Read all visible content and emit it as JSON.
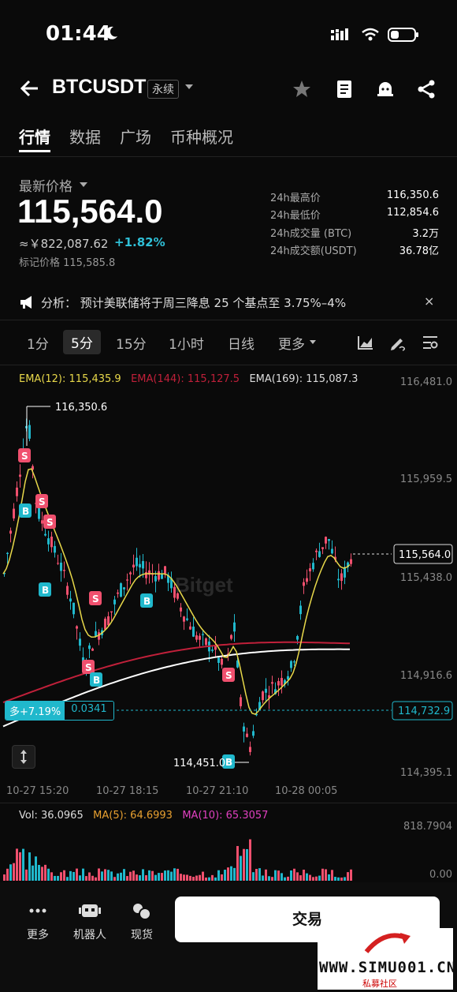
{
  "status": {
    "time": "01:44"
  },
  "header": {
    "symbol": "BTCUSDT",
    "badge": "永续"
  },
  "tabs": [
    "行情",
    "数据",
    "广场",
    "币种概况"
  ],
  "ticker": {
    "last_label": "最新价格",
    "price": "115,564.0",
    "cny": "≈￥822,087.62",
    "change": "+1.82%",
    "mark": "标记价格 115,585.8",
    "stats": [
      {
        "label": "24h最高价",
        "value": "116,350.6"
      },
      {
        "label": "24h最低价",
        "value": "112,854.6"
      },
      {
        "label": "24h成交量 (BTC)",
        "value": "3.2万"
      },
      {
        "label": "24h成交额(USDT)",
        "value": "36.78亿"
      }
    ]
  },
  "notice": {
    "text": "分析：  预计美联储将于周三降息 25 个基点至 3.75%–4%",
    "close": "×"
  },
  "intervals": [
    "1分",
    "5分",
    "15分",
    "1小时",
    "日线",
    "更多"
  ],
  "ema": {
    "ema12": "EMA(12): 115,435.9",
    "ema144": "EMA(144): 115,127.5",
    "ema169": "EMA(169): 115,087.3"
  },
  "chart_data": {
    "type": "candlestick",
    "y_axis_labels": [
      "116,481.0",
      "115,959.5",
      "115,438.0",
      "114,916.6",
      "114,395.1"
    ],
    "ylim": [
      114395.1,
      116481.0
    ],
    "x_axis_labels": [
      "10-27 15:20",
      "10-27 18:15",
      "10-27 21:10",
      "10-28 00:05"
    ],
    "high_label": "116,350.6",
    "low_label": "114,451.0",
    "current_price_label": "115,564.0",
    "position_line": {
      "label": "多+7.19%",
      "size": "0.0341",
      "price_label": "114,732.9"
    },
    "watermark": "Bitget",
    "trade_markers": [
      "S",
      "B",
      "S",
      "S",
      "B",
      "S",
      "S",
      "B",
      "B",
      "S",
      "B"
    ],
    "colors": {
      "up": "#20b8cc",
      "down": "#f0506e",
      "ema12": "#e8d84a",
      "ema144": "#c0203a",
      "ema169": "#ffffff"
    }
  },
  "volume": {
    "vol": "Vol: 36.0965",
    "ma5": "MA(5): 64.6993",
    "ma10": "MA(10): 65.3057",
    "y_top": "818.7904",
    "y_bottom": "0.00"
  },
  "bottom_nav": [
    {
      "label": "更多",
      "icon": "more-icon"
    },
    {
      "label": "机器人",
      "icon": "robot-icon"
    },
    {
      "label": "现货",
      "icon": "spot-icon"
    }
  ],
  "trade_button": "交易",
  "watermark_site": {
    "text": "WWW.SIMU001.CN",
    "sub": "私募社区"
  }
}
